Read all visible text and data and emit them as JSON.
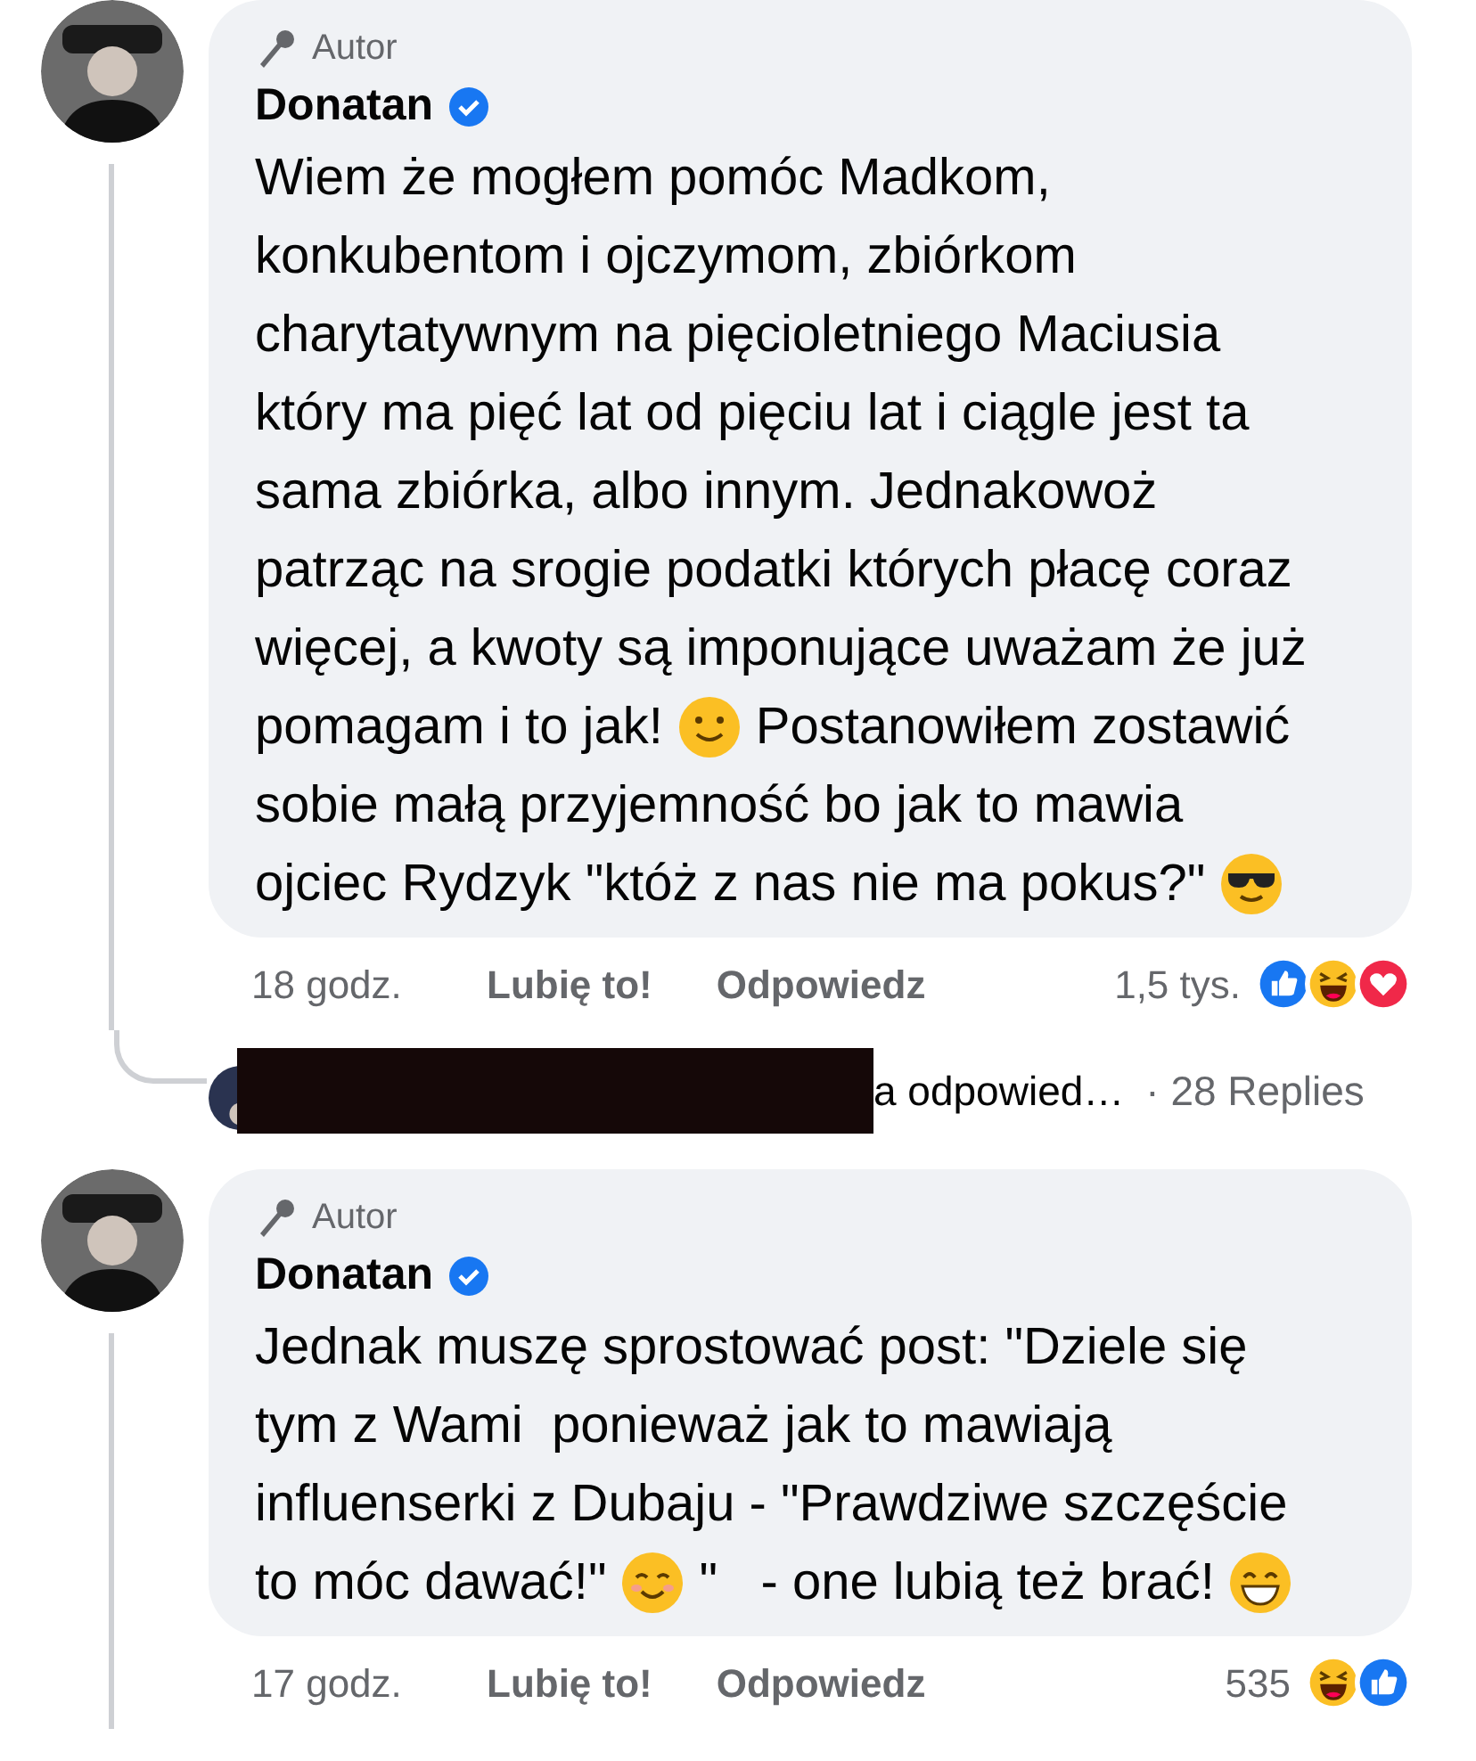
{
  "comments": [
    {
      "badge": "Autor",
      "author": "Donatan",
      "verified": true,
      "lines": [
        [
          {
            "kind": "text",
            "text": "Wiem że mogłem pomóc Madkom,"
          }
        ],
        [
          {
            "kind": "text",
            "text": "konkubentom i ojczymom, zbiórkom"
          }
        ],
        [
          {
            "kind": "text",
            "text": "charytatywnym na pięcioletniego Maciusia"
          }
        ],
        [
          {
            "kind": "text",
            "text": "który ma pięć lat od pięciu lat i ciągle jest ta"
          }
        ],
        [
          {
            "kind": "text",
            "text": "sama zbiórka, albo innym. Jednakowoż"
          }
        ],
        [
          {
            "kind": "text",
            "text": "patrząc na srogie podatki których płacę coraz"
          }
        ],
        [
          {
            "kind": "text",
            "text": "więcej, a kwoty są imponujące uważam że już"
          }
        ],
        [
          {
            "kind": "text",
            "text": "pomagam i to jak!"
          },
          {
            "kind": "smile"
          },
          {
            "kind": "text",
            "text": "Postanowiłem zostawić"
          }
        ],
        [
          {
            "kind": "text",
            "text": "sobie małą przyjemność bo jak to mawia"
          }
        ],
        [
          {
            "kind": "text",
            "text": "ojciec Rydzyk \"któż z nas nie ma pokus?\""
          },
          {
            "kind": "cool"
          }
        ]
      ],
      "time": "18 godz.",
      "like": "Lubię to!",
      "reply": "Odpowiedz",
      "count": "1,5 tys.",
      "reactions": [
        {
          "kind": "like"
        },
        {
          "kind": "haha"
        },
        {
          "kind": "love"
        }
      ],
      "replies_preview": {
        "text": "a odpowied…",
        "count": "· 28 Replies"
      }
    },
    {
      "badge": "Autor",
      "author": "Donatan",
      "verified": true,
      "lines": [
        [
          {
            "kind": "text",
            "text": "Jednak muszę sprostować post: \"Dziele się"
          }
        ],
        [
          {
            "kind": "text",
            "text": "tym z Wami  ponieważ jak to mawiają"
          }
        ],
        [
          {
            "kind": "text",
            "text": "influenserki z Dubaju - \"Prawdziwe szczęście"
          }
        ],
        [
          {
            "kind": "text",
            "text": "to móc dawać!\""
          },
          {
            "kind": "blush"
          },
          {
            "kind": "text",
            "text": "\"   - one lubią też brać!"
          },
          {
            "kind": "grin"
          }
        ]
      ],
      "time": "17 godz.",
      "like": "Lubię to!",
      "reply": "Odpowiedz",
      "count": "535",
      "reactions": [
        {
          "kind": "haha"
        },
        {
          "kind": "like"
        }
      ]
    }
  ]
}
